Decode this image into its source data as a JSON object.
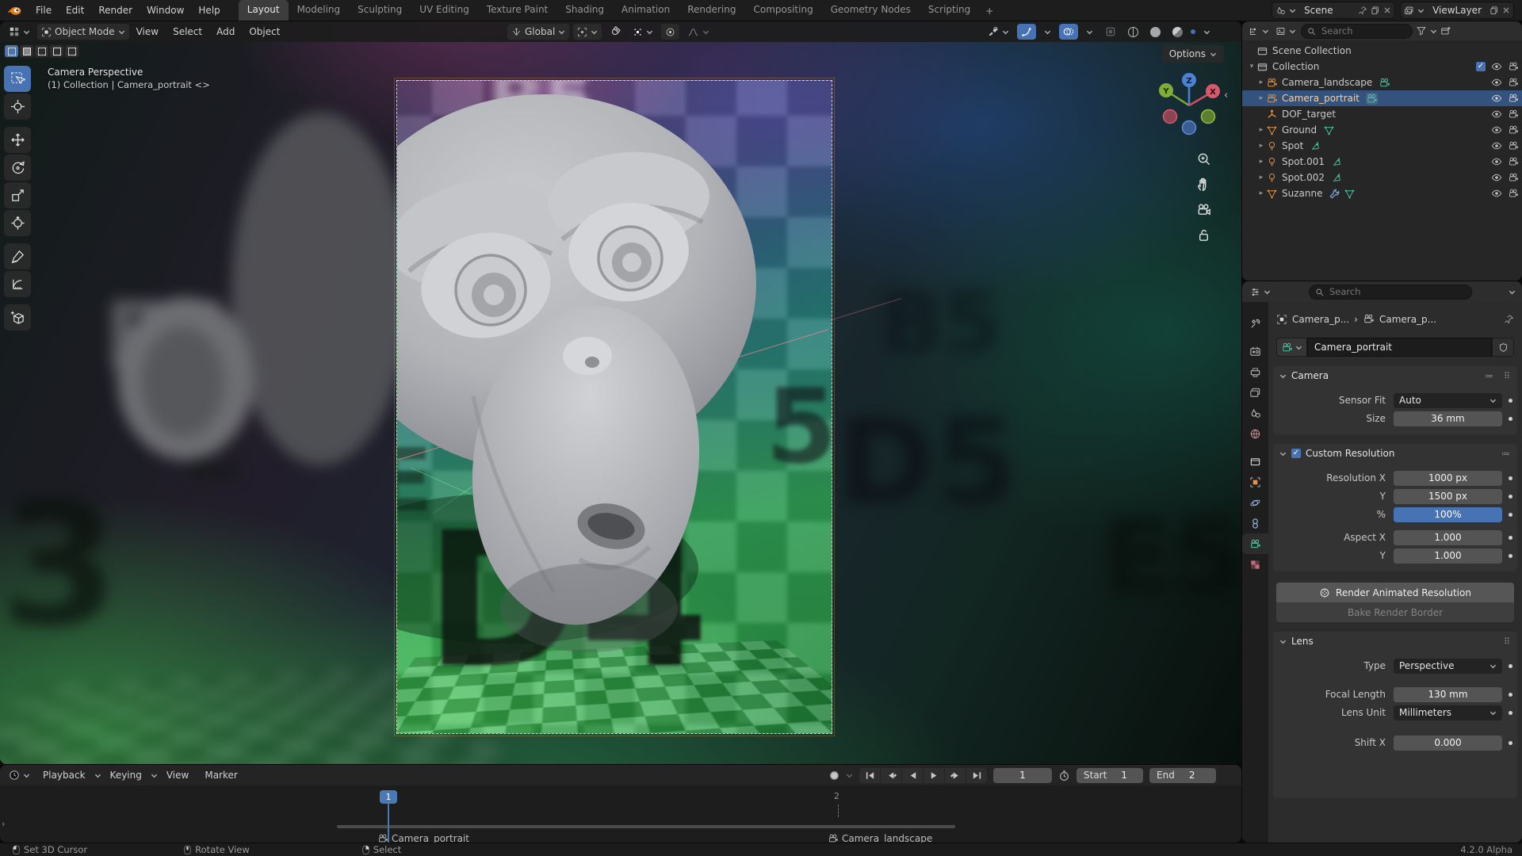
{
  "topbar": {
    "menus": [
      "File",
      "Edit",
      "Render",
      "Window",
      "Help"
    ],
    "workspaces": [
      "Layout",
      "Modeling",
      "Sculpting",
      "UV Editing",
      "Texture Paint",
      "Shading",
      "Animation",
      "Rendering",
      "Compositing",
      "Geometry Nodes",
      "Scripting"
    ],
    "add_workspace": "+",
    "scene_name": "Scene",
    "view_layer_name": "ViewLayer"
  },
  "viewport": {
    "mode": "Object Mode",
    "menus": [
      "View",
      "Select",
      "Add",
      "Object"
    ],
    "orientation": "Global",
    "options_label": "Options",
    "overlay_title": "Camera Perspective",
    "overlay_subtitle": "(1) Collection | Camera_portrait <>",
    "axis": {
      "x": "X",
      "y": "Y",
      "z": "Z"
    },
    "letters": [
      "F4",
      "E",
      "3",
      "D5",
      "B5",
      "E5",
      "D4",
      "5",
      "E",
      "B5"
    ]
  },
  "outliner": {
    "search_placeholder": "Search",
    "rows": [
      {
        "label": "Scene Collection"
      },
      {
        "label": "Collection"
      },
      {
        "label": "Camera_landscape"
      },
      {
        "label": "Camera_portrait"
      },
      {
        "label": "DOF_target"
      },
      {
        "label": "Ground"
      },
      {
        "label": "Spot"
      },
      {
        "label": "Spot.001"
      },
      {
        "label": "Spot.002"
      },
      {
        "label": "Suzanne"
      }
    ]
  },
  "properties": {
    "search_placeholder": "Search",
    "breadcrumb": {
      "object": "Camera_p...",
      "separator": "›",
      "data": "Camera_p..."
    },
    "id_name": "Camera_portrait",
    "camera_panel": {
      "title": "Camera",
      "rows": [
        {
          "label": "Sensor Fit",
          "value": "Auto"
        },
        {
          "label": "Size",
          "value": "36 mm"
        }
      ]
    },
    "resolution_panel": {
      "title": "Custom Resolution",
      "rows": [
        {
          "label": "Resolution X",
          "value": "1000 px"
        },
        {
          "label": "Y",
          "value": "1500 px"
        },
        {
          "label": "%",
          "value": "100%"
        },
        {
          "label": "Aspect X",
          "value": "1.000"
        },
        {
          "label": "Y",
          "value": "1.000"
        }
      ],
      "buttons": [
        "Render Animated Resolution",
        "Bake Render Border"
      ]
    },
    "lens_panel": {
      "title": "Lens",
      "rows": [
        {
          "label": "Type",
          "value": "Perspective"
        },
        {
          "label": "Focal Length",
          "value": "130 mm"
        },
        {
          "label": "Lens Unit",
          "value": "Millimeters"
        },
        {
          "label": "Shift X",
          "value": "0.000"
        }
      ]
    }
  },
  "timeline": {
    "menus": [
      "Playback",
      "Keying",
      "View",
      "Marker"
    ],
    "current_frame": "1",
    "start_label": "Start",
    "start_value": "1",
    "end_label": "End",
    "end_value": "2",
    "playhead_frame": "1",
    "tick_frame": "2",
    "markers": [
      {
        "label": "Camera_portrait"
      },
      {
        "label": "Camera_landscape"
      }
    ]
  },
  "statusbar": {
    "hints": [
      "Set 3D Cursor",
      "Rotate View",
      "Select"
    ],
    "version": "4.2.0 Alpha"
  },
  "colors": {
    "accent": "#4772b3",
    "selection_row": "#33527e",
    "active_object_text": "#ffce8f",
    "object_icon": "#e8923c",
    "data_icon": "#45c5a2",
    "modifier_icon": "#7ba9dd"
  }
}
